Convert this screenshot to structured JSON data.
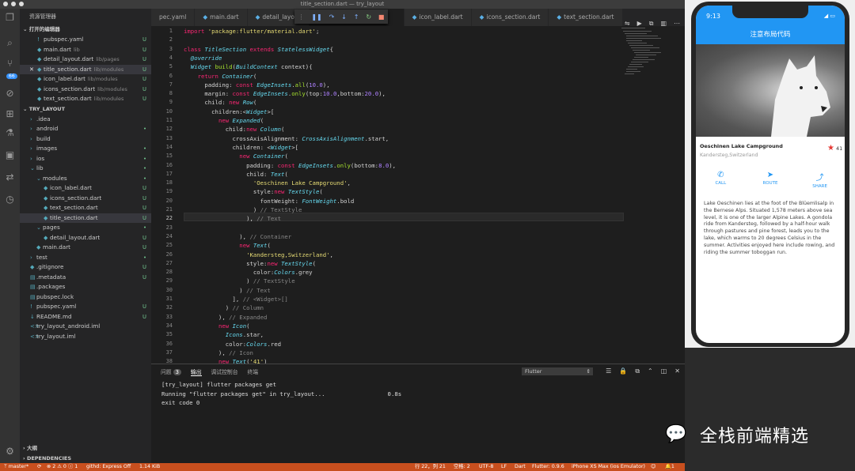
{
  "window": {
    "title": "title_section.dart — try_layout"
  },
  "sidebar": {
    "header": "资源管理器",
    "open_editors_label": "打开的编辑器",
    "project_label": "TRY_LAYOUT",
    "outline_label": "大纲",
    "deps_label": "DEPENDENCIES",
    "open_editors": [
      {
        "name": "pubspec.yaml",
        "path": "",
        "status": "U",
        "icon": "!"
      },
      {
        "name": "main.dart",
        "path": "lib",
        "status": "U",
        "icon": "◆"
      },
      {
        "name": "detail_layout.dart",
        "path": "lib/pages",
        "status": "U",
        "icon": "◆"
      },
      {
        "name": "title_section.dart",
        "path": "lib/modules",
        "status": "U",
        "icon": "◆",
        "prefix": "✕"
      },
      {
        "name": "icon_label.dart",
        "path": "lib/modules",
        "status": "U",
        "icon": "◆"
      },
      {
        "name": "icons_section.dart",
        "path": "lib/modules",
        "status": "U",
        "icon": "◆"
      },
      {
        "name": "text_section.dart",
        "path": "lib/modules",
        "status": "U",
        "icon": "◆"
      }
    ],
    "tree": [
      {
        "name": ".idea",
        "status": "",
        "icon": "›"
      },
      {
        "name": "android",
        "status": "•",
        "icon": "›"
      },
      {
        "name": "build",
        "status": "",
        "icon": "›"
      },
      {
        "name": "images",
        "status": "•",
        "icon": "›"
      },
      {
        "name": "ios",
        "status": "•",
        "icon": "›"
      },
      {
        "name": "lib",
        "status": "•",
        "icon": "⌄"
      },
      {
        "name": "modules",
        "status": "•",
        "icon": "⌄"
      },
      {
        "name": "icon_label.dart",
        "status": "U",
        "icon": "◆"
      },
      {
        "name": "icons_section.dart",
        "status": "U",
        "icon": "◆"
      },
      {
        "name": "text_section.dart",
        "status": "U",
        "icon": "◆"
      },
      {
        "name": "title_section.dart",
        "status": "U",
        "icon": "◆"
      },
      {
        "name": "pages",
        "status": "•",
        "icon": "⌄"
      },
      {
        "name": "detail_layout.dart",
        "status": "U",
        "icon": "◆"
      },
      {
        "name": "main.dart",
        "status": "U",
        "icon": "◆"
      },
      {
        "name": "test",
        "status": "•",
        "icon": "›"
      },
      {
        "name": ".gitignore",
        "status": "U",
        "icon": "◆"
      },
      {
        "name": ".metadata",
        "status": "U",
        "icon": "▤"
      },
      {
        "name": ".packages",
        "status": "",
        "icon": "▤"
      },
      {
        "name": "pubspec.lock",
        "status": "",
        "icon": "▤"
      },
      {
        "name": "pubspec.yaml",
        "status": "U",
        "icon": "!"
      },
      {
        "name": "README.md",
        "status": "U",
        "icon": "↓"
      },
      {
        "name": "try_layout_android.iml",
        "status": "",
        "icon": "<>"
      },
      {
        "name": "try_layout.iml",
        "status": "",
        "icon": "<>"
      }
    ]
  },
  "tabs": [
    {
      "label": "pec.yaml"
    },
    {
      "label": "main.dart"
    },
    {
      "label": "detail_layout"
    },
    {
      "label": "icon_label.dart"
    },
    {
      "label": "icons_section.dart"
    },
    {
      "label": "text_section.dart"
    }
  ],
  "activity": {
    "badge": "66"
  },
  "editor": {
    "start_line": 1,
    "current_line": 22,
    "lines_html": [
      "<span class=\"kw\">import</span> <span class=\"st\">'package:flutter/material.dart'</span>;",
      "",
      "<span class=\"kw\">class</span> <span class=\"ty\">TitleSection</span> <span class=\"kw\">extends</span> <span class=\"ty\">StatelessWidget</span>{",
      "  <span class=\"ty\">@override</span>",
      "  <span class=\"ty\">Widget</span> <span class=\"fn\">build</span>(<span class=\"ty\">BuildContext</span> context){",
      "    <span class=\"kw\">return</span> <span class=\"ty\">Container</span>(",
      "      padding: <span class=\"kw\">const</span> <span class=\"ty\">EdgeInsets</span>.<span class=\"fn\">all</span>(<span class=\"nu\">10.0</span>),",
      "      margin: <span class=\"kw\">const</span> <span class=\"ty\">EdgeInsets</span>.<span class=\"fn\">only</span>(top:<span class=\"nu\">10.0</span>,bottom:<span class=\"nu\">20.0</span>),",
      "      child: <span class=\"kw\">new</span> <span class=\"ty\">Row</span>(",
      "        children:&lt;<span class=\"ty\">Widget</span>&gt;[",
      "          <span class=\"kw\">new</span> <span class=\"ty\">Expanded</span>(",
      "            child:<span class=\"kw\">new</span> <span class=\"ty\">Column</span>(",
      "              crossAxisAlignment: <span class=\"ty\">CrossAxisAlignment</span>.start,",
      "              children: &lt;<span class=\"ty\">Widget</span>&gt;[",
      "                <span class=\"kw\">new</span> <span class=\"ty\">Container</span>(",
      "                  padding: <span class=\"kw\">const</span> <span class=\"ty\">EdgeInsets</span>.<span class=\"fn\">only</span>(bottom:<span class=\"nu\">8.0</span>),",
      "                  child: <span class=\"ty\">Text</span>(",
      "                    <span class=\"st\">'Oeschinen Lake Campground'</span>,",
      "                    style:<span class=\"kw\">new</span> <span class=\"ty\">TextStyle</span>(",
      "                      fontWeight: <span class=\"ty\">FontWeight</span>.bold",
      "                    ) <span class=\"cm\">// TextStyle</span>",
      "                  ), <span class=\"cm\">// Text</span>",
      "",
      "                ), <span class=\"cm\">// Container</span>",
      "                <span class=\"kw\">new</span> <span class=\"ty\">Text</span>(",
      "                  <span class=\"st\">'Kandersteg,Switzerland'</span>,",
      "                  style:<span class=\"kw\">new</span> <span class=\"ty\">TextStyle</span>(",
      "                    color:<span class=\"ty\">Colors</span>.grey",
      "                  ) <span class=\"cm\">// TextStyle</span>",
      "                ) <span class=\"cm\">// Text</span>",
      "              ], <span class=\"cm\">// &lt;Widget&gt;[]</span>",
      "            ) <span class=\"cm\">// Column</span>",
      "          ), <span class=\"cm\">// Expanded</span>",
      "          <span class=\"kw\">new</span> <span class=\"ty\">Icon</span>(",
      "            <span class=\"ty\">Icons</span>.star,",
      "            color:<span class=\"ty\">Colors</span>.red",
      "          ), <span class=\"cm\">// Icon</span>",
      "          <span class=\"kw\">new</span> <span class=\"ty\">Text</span>(<span class=\"st\">'41'</span>)"
    ]
  },
  "panel": {
    "tabs": [
      "问题",
      "输出",
      "调试控制台",
      "终端"
    ],
    "problem_count": "3",
    "selector": "Flutter",
    "output": "[try_layout] flutter packages get\nRunning \"flutter packages get\" in try_layout...                  0.8s\nexit code 0"
  },
  "status": {
    "branch": "ᛘ master*",
    "sync": "⟳",
    "errors": "⊗ 2 ⚠ 0 ⓘ 1",
    "githd": "githd: Express Off",
    "size": "1.14 KiB",
    "pos": "行 22，列 21",
    "spaces": "空格: 2",
    "enc": "UTF-8",
    "eol": "LF",
    "lang": "Dart",
    "flutter": "Flutter: 0.9.6",
    "device": "iPhone XS Max (ios Emulator)",
    "bell": "🔔1"
  },
  "phone": {
    "time": "9:13",
    "app_title": "注意布局代码",
    "place": "Oeschinen Lake Campground",
    "location": "Kandersteg,Switzerland",
    "star_count": "41",
    "buttons": [
      {
        "label": "CALL",
        "icon": "✆"
      },
      {
        "label": "ROUTE",
        "icon": "➤"
      },
      {
        "label": "SHARE",
        "icon": "⤴"
      }
    ],
    "description": "Lake Oeschinen lies at the foot of the Blüemlisalp in the Bernese Alps. Situated 1,578 meters above sea level, it is one of the larger Alpine Lakes. A gondola ride from Kandersteg, followed by a half-hour walk through pastures and pine forest, leads you to the lake, which warms to 20 degrees Celsius in the summer. Activities enjoyed here include rowing, and riding the summer toboggan run."
  },
  "brand": {
    "text": "全栈前端精选"
  }
}
